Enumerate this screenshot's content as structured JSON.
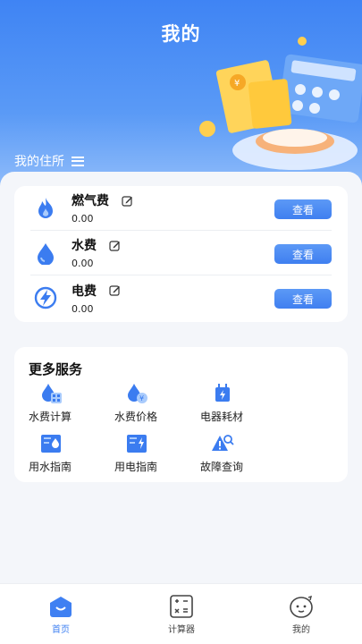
{
  "header": {
    "title": "我的",
    "residence_label": "我的住所"
  },
  "bills": [
    {
      "name": "燃气费",
      "amount": "0.00",
      "button": "查看",
      "icon": "flame-icon"
    },
    {
      "name": "水费",
      "amount": "0.00",
      "button": "查看",
      "icon": "water-drop-icon"
    },
    {
      "name": "电费",
      "amount": "0.00",
      "button": "查看",
      "icon": "lightning-icon"
    }
  ],
  "services": {
    "title": "更多服务",
    "items": [
      {
        "label": "水费计算",
        "icon": "water-calculator-icon"
      },
      {
        "label": "水费价格",
        "icon": "water-price-icon"
      },
      {
        "label": "电器耗材",
        "icon": "appliance-icon"
      },
      {
        "label": "用水指南",
        "icon": "water-guide-icon"
      },
      {
        "label": "用电指南",
        "icon": "electric-guide-icon"
      },
      {
        "label": "故障查询",
        "icon": "fault-warning-icon"
      }
    ]
  },
  "tabbar": [
    {
      "label": "首页",
      "icon": "home-icon",
      "active": true
    },
    {
      "label": "计算器",
      "icon": "calculator-icon",
      "active": false
    },
    {
      "label": "我的",
      "icon": "profile-icon",
      "active": false
    }
  ],
  "colors": {
    "accent": "#3f80f2",
    "hero_top": "#3f84f4",
    "background": "#f4f6fa"
  }
}
